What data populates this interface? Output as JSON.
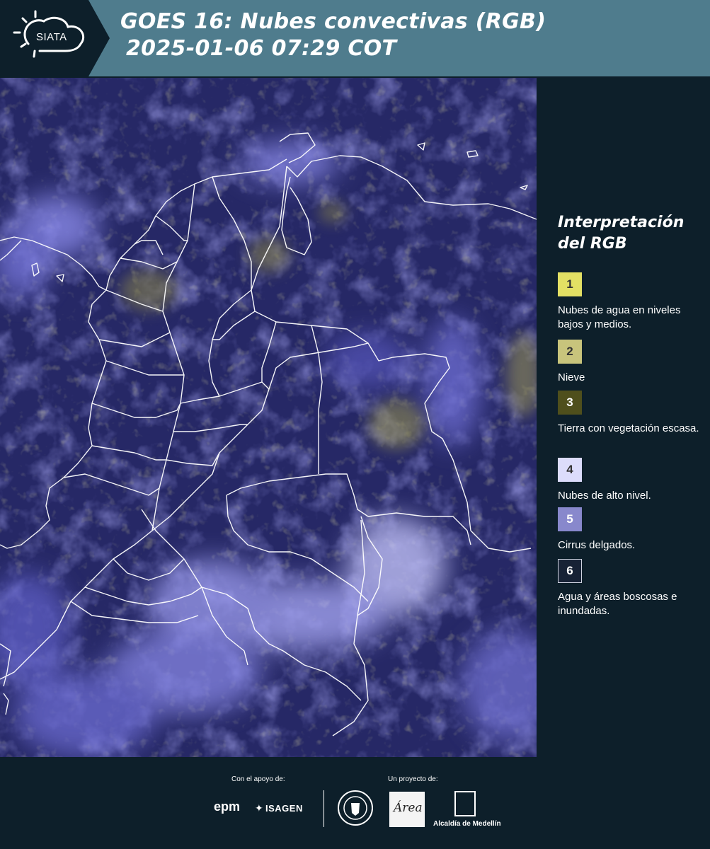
{
  "header": {
    "logo_text": "SIATA",
    "title_line1": "GOES 16: Nubes convectivas (RGB)",
    "title_line2": "2025-01-06 07:29 COT",
    "background_color": "#4f7c8d"
  },
  "map": {
    "description_icon": "satellite-rgb-image",
    "base_color": "#232460"
  },
  "legend": {
    "title": "Interpretación del RGB",
    "items": [
      {
        "number": "1",
        "label": "Nubes de agua en niveles bajos y medios.",
        "color": "#e3e064"
      },
      {
        "number": "2",
        "label": "Nieve",
        "color": "#c8c47c"
      },
      {
        "number": "3",
        "label": "Tierra con vegetación escasa.",
        "color": "#4f4f1c"
      },
      {
        "number": "4",
        "label": "Nubes de alto nivel.",
        "color": "#dcdcfb"
      },
      {
        "number": "5",
        "label": "Cirrus delgados.",
        "color": "#8888cc"
      },
      {
        "number": "6",
        "label": "Agua y áreas boscosas e inundadas.",
        "color": "#172235"
      }
    ]
  },
  "footer": {
    "support_label": "Con el apoyo de:",
    "project_label": "Un proyecto de:",
    "sponsors": [
      "epm",
      "ISAGEN"
    ],
    "partners": [
      "Área Metropolitana Valle de Aburrá",
      "Alcaldía de Medellín"
    ],
    "area_logo_text": "Área",
    "alcaldia_text": "Alcaldía de Medellín"
  }
}
